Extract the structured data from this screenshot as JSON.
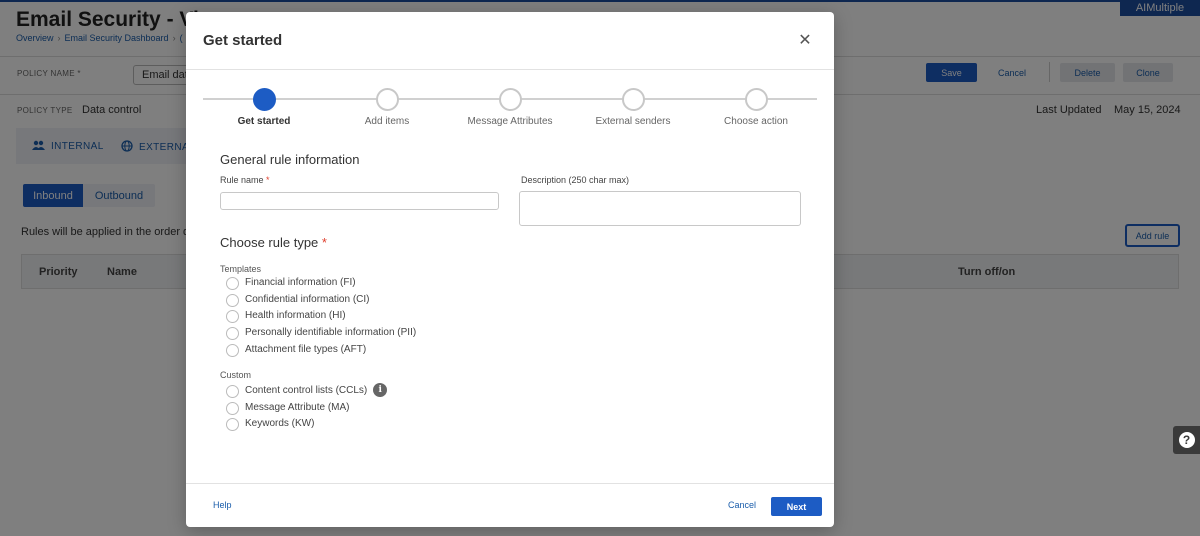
{
  "brand": {
    "badge": "AIMultiple"
  },
  "page": {
    "title": "Email Security - Vie",
    "breadcrumb": [
      "Overview",
      "Email Security Dashboard",
      "("
    ],
    "policy_name_label": "POLICY NAME *",
    "policy_name_value": "Email dat",
    "policy_type_label": "POLICY TYPE",
    "policy_type_value": "Data control",
    "last_updated_label": "Last Updated",
    "last_updated_value": "May 15, 2024",
    "buttons": {
      "save": "Save",
      "cancel": "Cancel",
      "delete": "Delete",
      "clone": "Clone"
    },
    "scope_tabs": [
      "INTERNAL",
      "EXTERNA"
    ],
    "direction_tabs": [
      "Inbound",
      "Outbound"
    ],
    "rules_note": "Rules will be applied in the order di",
    "add_rule": "Add rule",
    "table_headers": {
      "priority": "Priority",
      "name": "Name",
      "toggle": "Turn off/on"
    }
  },
  "modal": {
    "title": "Get started",
    "steps": [
      {
        "label": "Get started",
        "active": true
      },
      {
        "label": "Add items",
        "active": false
      },
      {
        "label": "Message Attributes",
        "active": false
      },
      {
        "label": "External senders",
        "active": false
      },
      {
        "label": "Choose action",
        "active": false
      }
    ],
    "general_title": "General rule information",
    "rule_name_label": "Rule name",
    "rule_name_value": "",
    "description_label": "Description (250 char max)",
    "description_value": "",
    "rule_type_title": "Choose rule type",
    "required_mark": "*",
    "templates_label": "Templates",
    "templates": [
      "Financial information (FI)",
      "Confidential information (CI)",
      "Health information (HI)",
      "Personally identifiable information (PII)",
      "Attachment file types (AFT)"
    ],
    "custom_label": "Custom",
    "custom": [
      "Content control lists (CCLs)",
      "Message Attribute (MA)",
      "Keywords (KW)"
    ],
    "footer": {
      "help": "Help",
      "cancel": "Cancel",
      "next": "Next"
    }
  },
  "icons": {
    "close": "close-icon",
    "internal": "people-icon",
    "external": "globe-icon",
    "info": "info-icon",
    "help": "question-icon"
  },
  "colors": {
    "primary": "#1d5cc4",
    "required": "#e0402e",
    "overlay": "rgba(0,0,0,0.5)"
  }
}
